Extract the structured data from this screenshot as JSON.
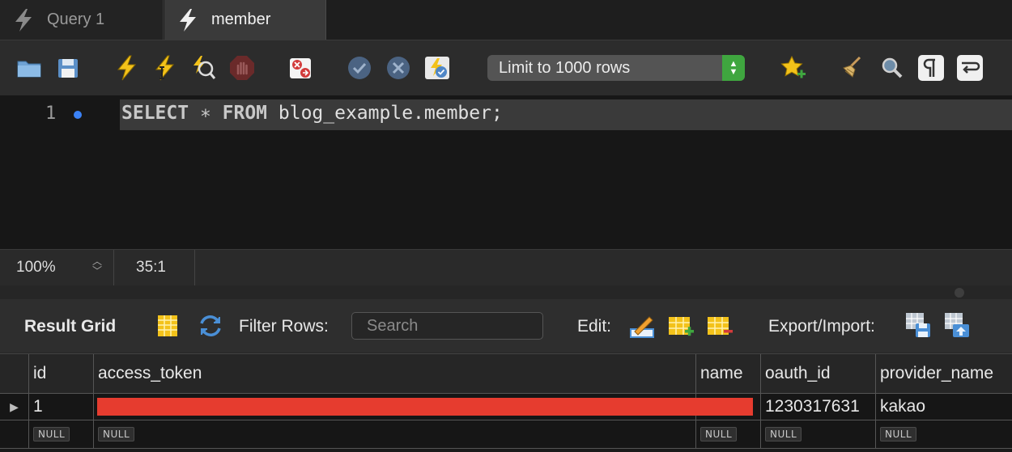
{
  "tabs": [
    {
      "label": "Query 1",
      "active": false
    },
    {
      "label": "member",
      "active": true
    }
  ],
  "toolbar": {
    "limit_select": "Limit to 1000 rows",
    "icons": [
      "open-folder-icon",
      "save-icon",
      "execute-icon",
      "execute-current-icon",
      "explain-icon",
      "stop-icon",
      "toggle-error-stop-icon",
      "commit-icon",
      "rollback-icon",
      "autocommit-icon",
      "add-snippet-icon",
      "beautify-icon",
      "find-icon",
      "invisible-chars-icon",
      "wrap-lines-icon"
    ]
  },
  "editor": {
    "line_number": "1",
    "code": {
      "kw1": "SELECT",
      "op": " ∗ ",
      "kw2": "FROM",
      "rest": " blog_example.member;"
    }
  },
  "status": {
    "zoom": "100%",
    "cursor": "35:1"
  },
  "result_toolbar": {
    "result_grid": "Result Grid",
    "filter_rows": "Filter Rows:",
    "search_placeholder": "Search",
    "edit": "Edit:",
    "export_import": "Export/Import:"
  },
  "grid": {
    "columns": [
      "id",
      "access_token",
      "name",
      "oauth_id",
      "provider_name"
    ],
    "rows": [
      {
        "id": "1",
        "access_token": "",
        "name": "",
        "oauth_id": "1230317631",
        "provider_name": "kakao"
      },
      {
        "id": "NULL",
        "access_token": "NULL",
        "name": "NULL",
        "oauth_id": "NULL",
        "provider_name": "NULL"
      }
    ]
  },
  "colors": {
    "accent_green": "#3fa63f",
    "redaction": "#e63c2f",
    "marker_blue": "#3b82f6"
  }
}
